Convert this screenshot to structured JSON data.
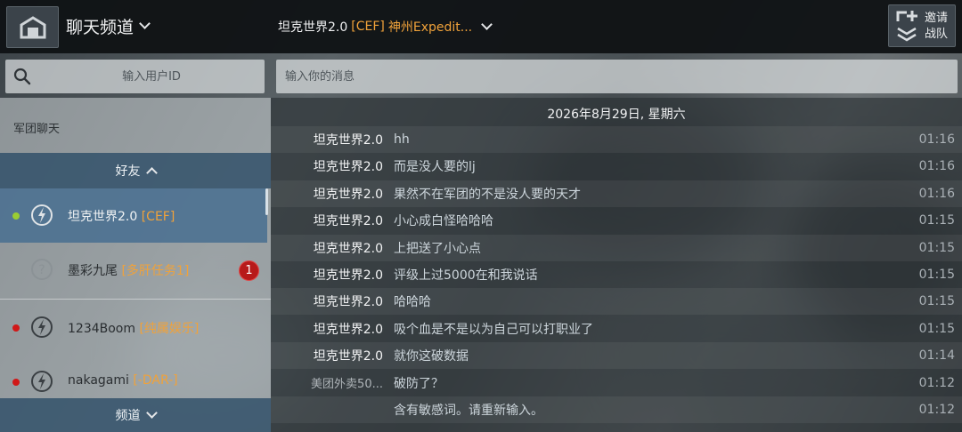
{
  "topbar": {
    "channel_title": "聊天频道",
    "conversation": {
      "name": "坦克世界2.0",
      "tag": "[CEF]",
      "subtitle": "神州Expedit..."
    },
    "invite_label_line1": "邀请",
    "invite_label_line2": "战队"
  },
  "search": {
    "placeholder": "输入用户ID"
  },
  "message_input": {
    "placeholder": "输入你的消息"
  },
  "sidebar": {
    "legion_chat": "军团聊天",
    "friends_header": "好友",
    "channels_header": "频道",
    "friends": [
      {
        "name": "坦克世界2.0",
        "tag": "[CEF]",
        "status_color": "#9acd32",
        "selected": true,
        "icon": "lightning-icon"
      },
      {
        "name": "墨彩九尾",
        "tag": "[多肝任务1]",
        "status_color": "",
        "unread": "1",
        "icon": "question-icon"
      },
      {
        "name": "1234Boom",
        "tag": "[纯属娱乐]",
        "status_color": "#d01818",
        "icon": "lightning-icon"
      },
      {
        "name": "nakagami",
        "tag": "[-DAR-]",
        "status_color": "#d01818",
        "icon": "lightning-icon"
      }
    ]
  },
  "chat": {
    "date": "2026年8月29日, 星期六",
    "messages": [
      {
        "sender": "坦克世界2.0",
        "text": "hh",
        "time": "01:16"
      },
      {
        "sender": "坦克世界2.0",
        "text": "而是没人要的lj",
        "time": "01:16"
      },
      {
        "sender": "坦克世界2.0",
        "text": "果然不在军团的不是没人要的天才",
        "time": "01:16"
      },
      {
        "sender": "坦克世界2.0",
        "text": "小心成白怪哈哈哈",
        "time": "01:15"
      },
      {
        "sender": "坦克世界2.0",
        "text": "上把送了小心点",
        "time": "01:15"
      },
      {
        "sender": "坦克世界2.0",
        "text": "评级上过5000在和我说话",
        "time": "01:15"
      },
      {
        "sender": "坦克世界2.0",
        "text": "哈哈哈",
        "time": "01:15"
      },
      {
        "sender": "坦克世界2.0",
        "text": "吸个血是不是以为自己可以打职业了",
        "time": "01:15"
      },
      {
        "sender": "坦克世界2.0",
        "text": "就你这破数据",
        "time": "01:14"
      },
      {
        "sender": "美团外卖50...",
        "text": "破防了？",
        "time": "01:12"
      },
      {
        "sender": "",
        "text": "含有敏感词。请重新输入。",
        "time": "01:12"
      }
    ]
  },
  "colors": {
    "accent_orange": "#f0a23a",
    "selected_row": "#4a7091",
    "section_header": "#2e4e68",
    "badge_red": "#b71a1a"
  }
}
